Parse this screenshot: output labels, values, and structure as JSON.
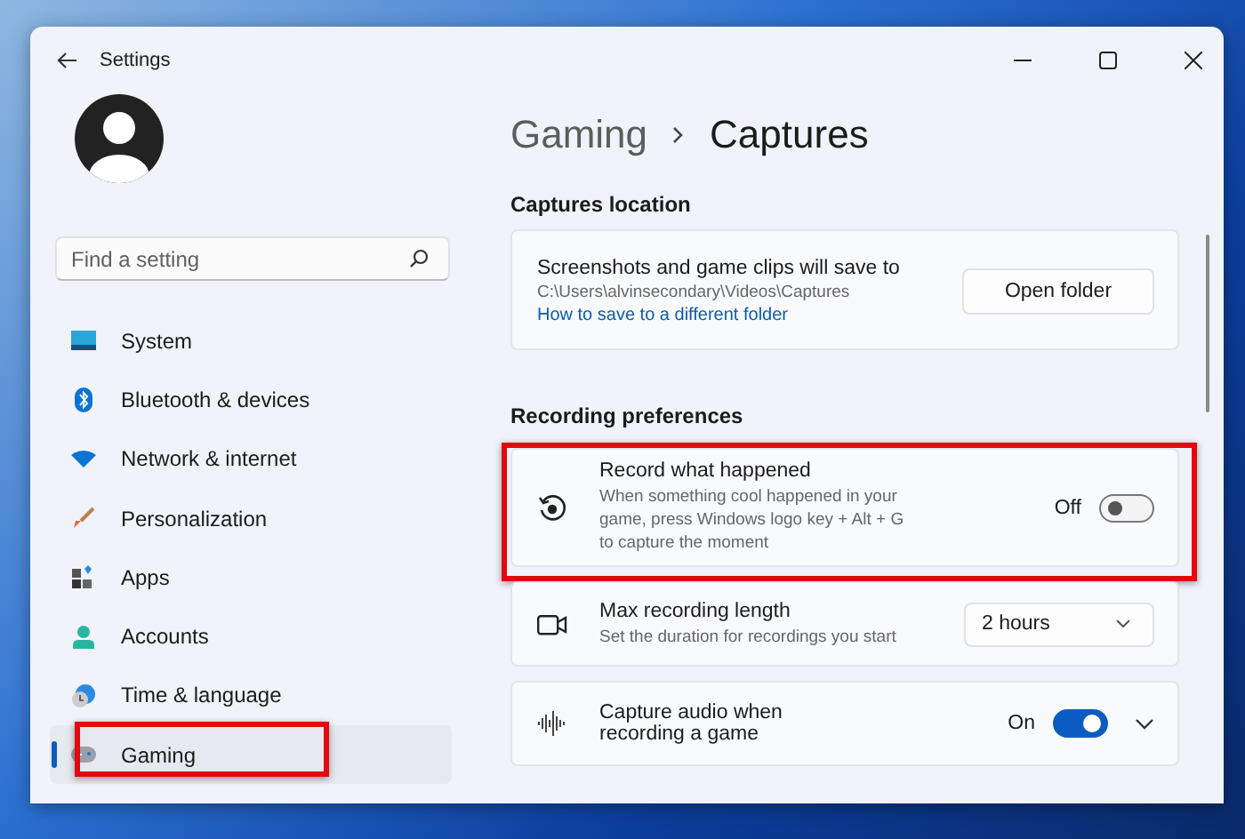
{
  "window": {
    "title": "Settings"
  },
  "search": {
    "placeholder": "Find a setting"
  },
  "sidebar": {
    "items": [
      {
        "label": "System",
        "selected": false,
        "highlighted": false
      },
      {
        "label": "Bluetooth & devices",
        "selected": false,
        "highlighted": false
      },
      {
        "label": "Network & internet",
        "selected": false,
        "highlighted": false
      },
      {
        "label": "Personalization",
        "selected": false,
        "highlighted": false
      },
      {
        "label": "Apps",
        "selected": false,
        "highlighted": false
      },
      {
        "label": "Accounts",
        "selected": false,
        "highlighted": false
      },
      {
        "label": "Time & language",
        "selected": false,
        "highlighted": false
      },
      {
        "label": "Gaming",
        "selected": true,
        "highlighted": true
      }
    ]
  },
  "breadcrumb": {
    "parent": "Gaming",
    "current": "Captures"
  },
  "captures_location": {
    "heading": "Captures location",
    "description": "Screenshots and game clips will save to",
    "path": "C:\\Users\\alvinsecondary\\Videos\\Captures",
    "link": "How to save to a different folder",
    "button": "Open folder"
  },
  "recording_preferences": {
    "heading": "Recording preferences",
    "settings": [
      {
        "kind": "toggle",
        "title": "Record what happened",
        "description": "When something cool happened in your game, press Windows logo key + Alt + G to capture the moment",
        "state_label": "Off",
        "on": false,
        "expandable": false,
        "highlighted": true
      },
      {
        "kind": "dropdown",
        "title": "Max recording length",
        "description": "Set the duration for recordings you start",
        "value": "2 hours",
        "highlighted": false
      },
      {
        "kind": "toggle",
        "title": "Capture audio when recording a game",
        "state_label": "On",
        "on": true,
        "expandable": true,
        "highlighted": false
      }
    ]
  }
}
